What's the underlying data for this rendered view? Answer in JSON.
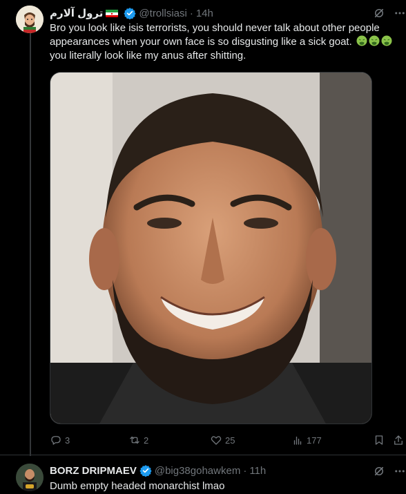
{
  "main_tweet": {
    "display_name": "ترول آلارم",
    "handle": "@trollsiasi",
    "time": "14h",
    "dot": "·",
    "text": "Bro you look like isis terrorists, you should never talk about other people appearances when your own face is so disgusting like a sick goat. 🤮🤮🤮 you literally look like my anus after shitting.",
    "text_main": "Bro you look like isis terrorists, you should never talk about other people appearances when your own face is so disgusting like a sick goat.",
    "text_tail": "you literally look like my anus after shitting.",
    "emojis": [
      "🤮",
      "🤮",
      "🤮"
    ],
    "media_icon": "portrait-photo",
    "actions": {
      "replies": "3",
      "reposts": "2",
      "likes": "25",
      "views": "177"
    }
  },
  "reply_tweet": {
    "display_name": "BORZ DRIPMAEV",
    "handle": "@big38gohawkem",
    "time": "11h",
    "dot": "·",
    "text": "Dumb empty headed monarchist lmao"
  },
  "colors": {
    "background": "#000000",
    "text_primary": "#e7e9ea",
    "text_secondary": "#71767b",
    "verified_blue": "#1d9bf0",
    "border": "#2f3336"
  }
}
